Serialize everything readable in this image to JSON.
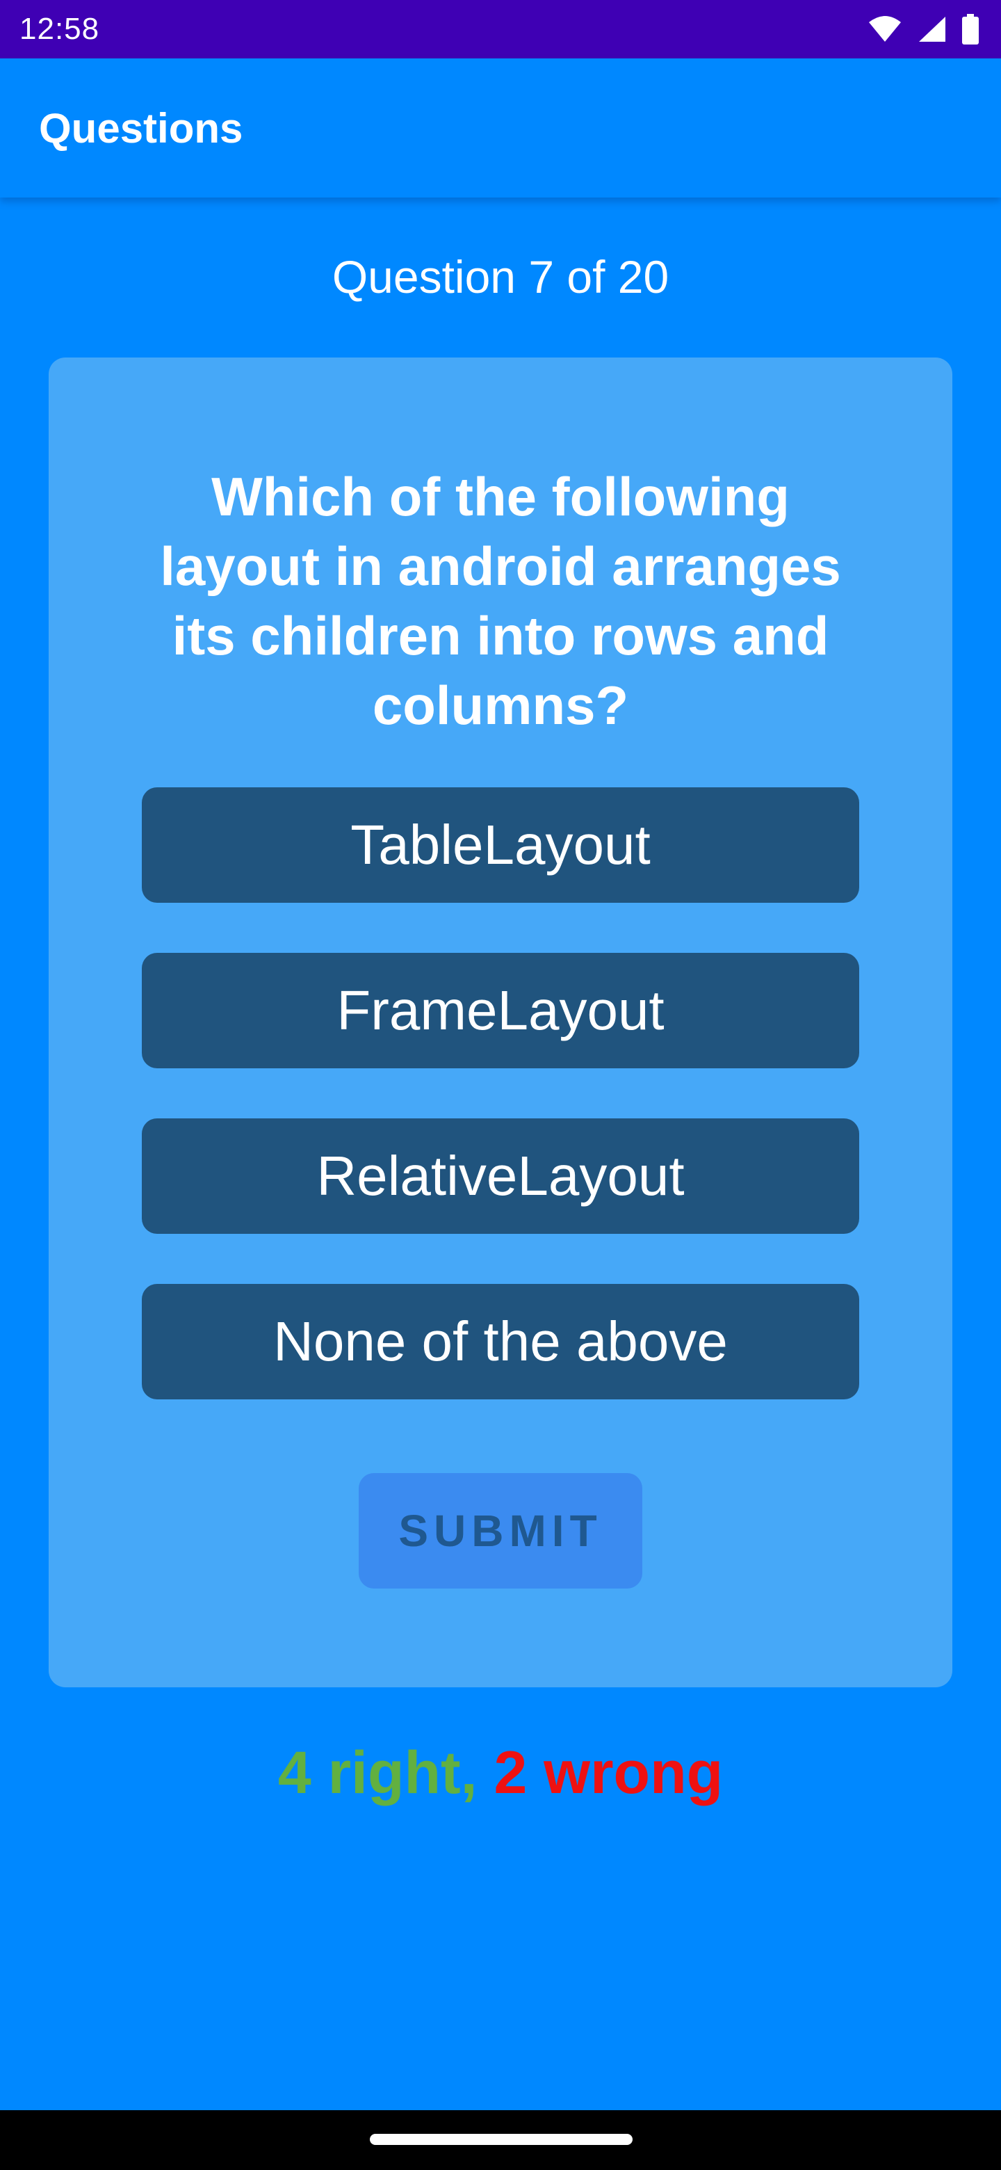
{
  "status_bar": {
    "time": "12:58",
    "icons": [
      "wifi-icon",
      "signal-icon",
      "battery-icon"
    ]
  },
  "app_bar": {
    "title": "Questions"
  },
  "quiz": {
    "counter": "Question 7 of 20",
    "question": "Which of the following layout in android arranges its children into rows and columns?",
    "answers": [
      "TableLayout",
      "FrameLayout",
      "RelativeLayout",
      "None of the above"
    ],
    "submit_label": "SUBMIT"
  },
  "score": {
    "right": "4 right,",
    "wrong": "2 wrong"
  },
  "colors": {
    "background": "#0088ff",
    "status_bar": "#3f00b4",
    "card": "#46a8f8",
    "answer_button": "#20547e",
    "submit_button": "#3b8bf0",
    "right": "#62b040",
    "wrong": "#ee1111"
  }
}
